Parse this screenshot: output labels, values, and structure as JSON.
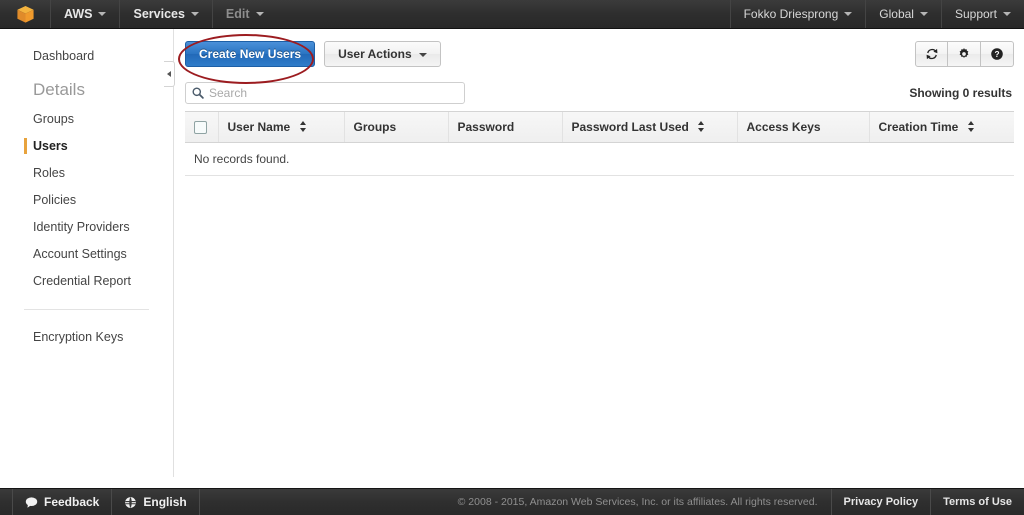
{
  "topnav": {
    "logo_icon": "aws-cube-logo",
    "items": [
      {
        "label": "AWS",
        "has_caret": true,
        "dim": false
      },
      {
        "label": "Services",
        "has_caret": true,
        "dim": false
      },
      {
        "label": "Edit",
        "has_caret": true,
        "dim": true
      }
    ],
    "right_items": [
      {
        "label": "Fokko Driesprong",
        "has_caret": true
      },
      {
        "label": "Global",
        "has_caret": true
      },
      {
        "label": "Support",
        "has_caret": true
      }
    ]
  },
  "sidebar": {
    "dashboard_label": "Dashboard",
    "details_heading": "Details",
    "items": [
      {
        "label": "Groups",
        "active": false
      },
      {
        "label": "Users",
        "active": true
      },
      {
        "label": "Roles",
        "active": false
      },
      {
        "label": "Policies",
        "active": false
      },
      {
        "label": "Identity Providers",
        "active": false
      },
      {
        "label": "Account Settings",
        "active": false
      },
      {
        "label": "Credential Report",
        "active": false
      }
    ],
    "encryption_label": "Encryption Keys",
    "active_marker_color": "#e8a33d",
    "collapse_icon": "chevron-left-icon"
  },
  "toolbar": {
    "create_users_label": "Create New Users",
    "user_actions_label": "User Actions",
    "primary_color": "#2a74c2",
    "icons": [
      {
        "name": "refresh-icon"
      },
      {
        "name": "gear-icon"
      },
      {
        "name": "help-icon"
      }
    ]
  },
  "annotation": {
    "shape": "ellipse",
    "color": "#9c1c20",
    "targets": "create-new-users-button"
  },
  "search": {
    "placeholder": "Search",
    "value": "",
    "icon": "search-icon",
    "results_text": "Showing 0 results"
  },
  "table": {
    "select_all_checkbox": "select-all-checkbox",
    "columns": [
      {
        "label": "User Name",
        "sortable": true
      },
      {
        "label": "Groups",
        "sortable": false
      },
      {
        "label": "Password",
        "sortable": false
      },
      {
        "label": "Password Last Used",
        "sortable": true
      },
      {
        "label": "Access Keys",
        "sortable": false
      },
      {
        "label": "Creation Time",
        "sortable": true
      }
    ],
    "empty_message": "No records found.",
    "rows": []
  },
  "footer": {
    "feedback_label": "Feedback",
    "feedback_icon": "speech-bubble-icon",
    "language_label": "English",
    "language_icon": "globe-icon",
    "copyright": "© 2008 - 2015, Amazon Web Services, Inc. or its affiliates. All rights reserved.",
    "privacy_label": "Privacy Policy",
    "terms_label": "Terms of Use"
  }
}
